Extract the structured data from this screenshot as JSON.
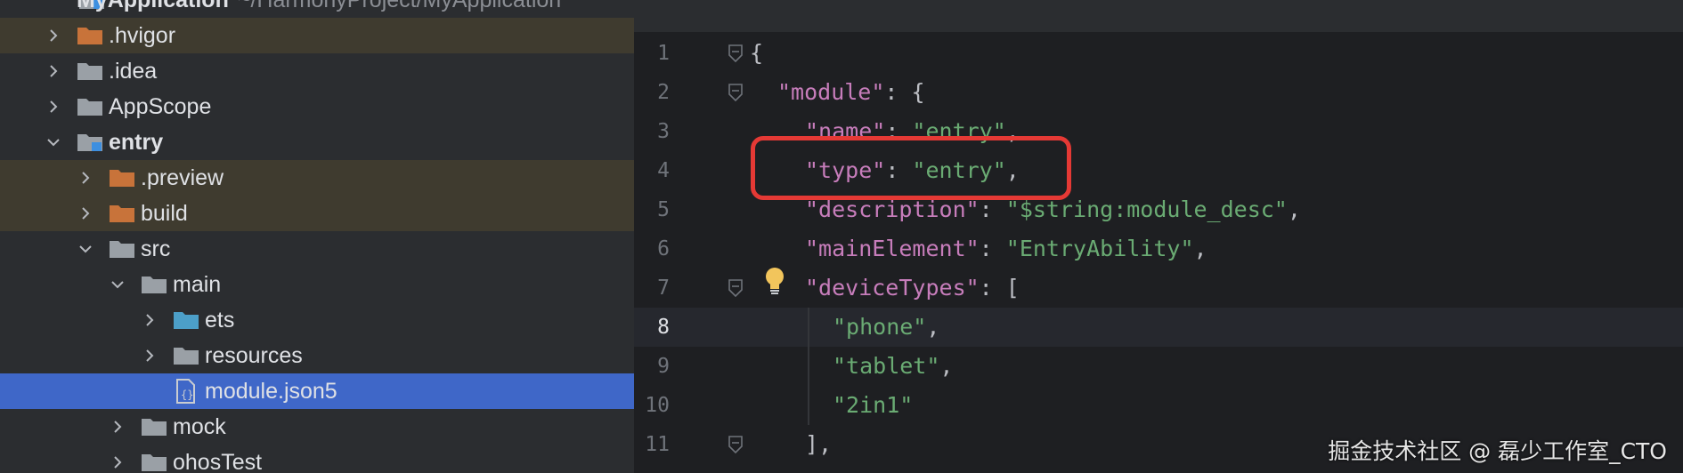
{
  "project": {
    "name": "MyApplication",
    "path": "~/HarmonyProject/MyApplication"
  },
  "tree": [
    {
      "label": ".hvigor",
      "depth": 0,
      "type": "folder-excluded",
      "chevron": "right",
      "excluded": true
    },
    {
      "label": ".idea",
      "depth": 0,
      "type": "folder",
      "chevron": "right"
    },
    {
      "label": "AppScope",
      "depth": 0,
      "type": "folder",
      "chevron": "right"
    },
    {
      "label": "entry",
      "depth": 0,
      "type": "module",
      "chevron": "down",
      "bold": true
    },
    {
      "label": ".preview",
      "depth": 1,
      "type": "folder-excluded",
      "chevron": "right",
      "excluded": true
    },
    {
      "label": "build",
      "depth": 1,
      "type": "folder-excluded",
      "chevron": "right",
      "excluded": true
    },
    {
      "label": "src",
      "depth": 1,
      "type": "folder",
      "chevron": "down"
    },
    {
      "label": "main",
      "depth": 2,
      "type": "folder",
      "chevron": "down"
    },
    {
      "label": "ets",
      "depth": 3,
      "type": "folder-source",
      "chevron": "right"
    },
    {
      "label": "resources",
      "depth": 3,
      "type": "folder",
      "chevron": "right"
    },
    {
      "label": "module.json5",
      "depth": 3,
      "type": "file-json",
      "chevron": "none",
      "selected": true
    },
    {
      "label": "mock",
      "depth": 2,
      "type": "folder",
      "chevron": "right"
    },
    {
      "label": "ohosTest",
      "depth": 2,
      "type": "folder",
      "chevron": "right"
    }
  ],
  "editor": {
    "current_line": 8,
    "lines": [
      {
        "n": "1",
        "fold": true,
        "tokens": [
          {
            "t": "{",
            "c": "p"
          }
        ]
      },
      {
        "n": "2",
        "fold": true,
        "tokens": [
          {
            "t": "\"module\"",
            "c": "k"
          },
          {
            "t": ": {",
            "c": "p"
          }
        ]
      },
      {
        "n": "3",
        "tokens": [
          {
            "t": "\"name\"",
            "c": "k"
          },
          {
            "t": ": ",
            "c": "p"
          },
          {
            "t": "\"entry\"",
            "c": "s"
          },
          {
            "t": ",",
            "c": "p"
          }
        ]
      },
      {
        "n": "4",
        "tokens": [
          {
            "t": "\"type\"",
            "c": "k"
          },
          {
            "t": ": ",
            "c": "p"
          },
          {
            "t": "\"entry\"",
            "c": "s"
          },
          {
            "t": ",",
            "c": "p"
          }
        ]
      },
      {
        "n": "5",
        "tokens": [
          {
            "t": "\"description\"",
            "c": "k"
          },
          {
            "t": ": ",
            "c": "p"
          },
          {
            "t": "\"$string:module_desc\"",
            "c": "s"
          },
          {
            "t": ",",
            "c": "p"
          }
        ]
      },
      {
        "n": "6",
        "tokens": [
          {
            "t": "\"mainElement\"",
            "c": "k"
          },
          {
            "t": ": ",
            "c": "p"
          },
          {
            "t": "\"EntryAbility\"",
            "c": "s"
          },
          {
            "t": ",",
            "c": "p"
          }
        ]
      },
      {
        "n": "7",
        "fold": true,
        "bulb": true,
        "tokens": [
          {
            "t": "\"deviceTypes\"",
            "c": "k"
          },
          {
            "t": ": [",
            "c": "p"
          }
        ]
      },
      {
        "n": "8",
        "tokens": [
          {
            "t": "\"phone\"",
            "c": "s"
          },
          {
            "t": ",",
            "c": "p"
          }
        ]
      },
      {
        "n": "9",
        "tokens": [
          {
            "t": "\"tablet\"",
            "c": "s"
          },
          {
            "t": ",",
            "c": "p"
          }
        ]
      },
      {
        "n": "10",
        "tokens": [
          {
            "t": "\"2in1\"",
            "c": "s"
          }
        ]
      },
      {
        "n": "11",
        "fold": true,
        "tokens": [
          {
            "t": "],",
            "c": "p"
          }
        ]
      }
    ]
  },
  "watermark": "掘金技术社区 @ 磊少工作室_CTO",
  "colors": {
    "keyword": "#c77dbb",
    "string": "#6aab73",
    "selection": "#3f67c8",
    "highlight_box": "#e53935"
  }
}
